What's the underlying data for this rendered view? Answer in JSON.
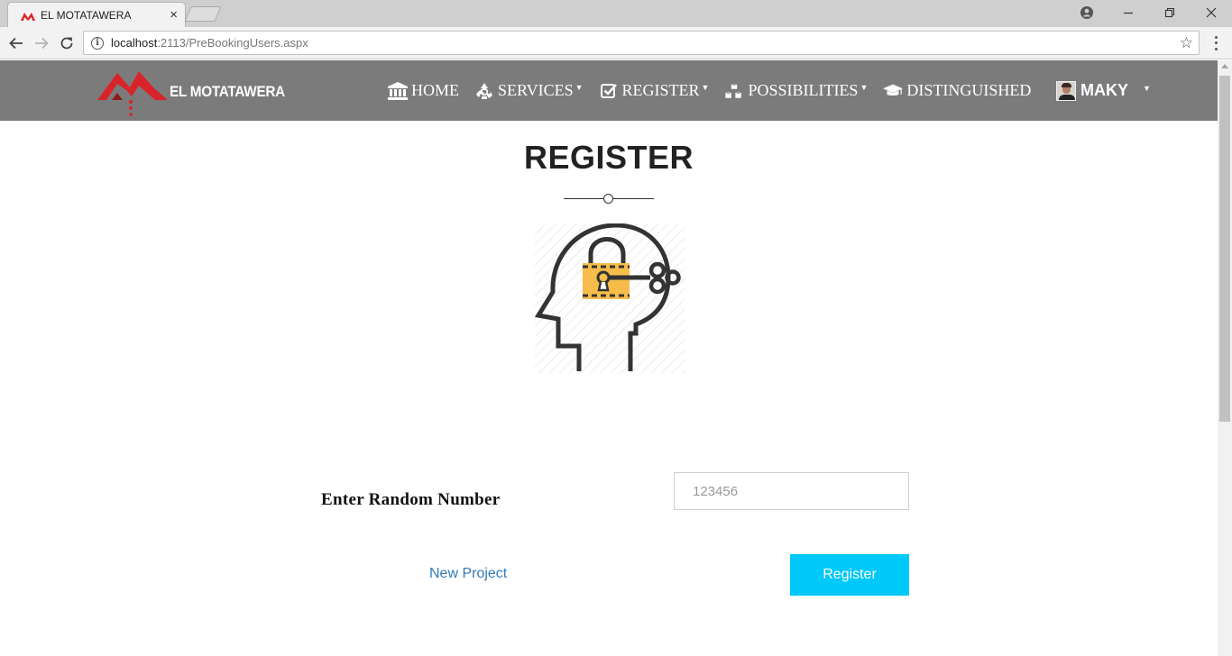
{
  "browser": {
    "tab_title": "EL MOTATAWERA",
    "tab_close": "×",
    "url_host": "localhost",
    "url_path": ":2113/PreBookingUsers.aspx"
  },
  "navbar": {
    "brand": "EL MOTATAWERA",
    "items": [
      {
        "label": "HOME",
        "icon": "bank-icon",
        "has_dropdown": false
      },
      {
        "label": "SERVICES",
        "icon": "recycle-icon",
        "has_dropdown": true
      },
      {
        "label": "REGISTER",
        "icon": "checkbox-icon",
        "has_dropdown": true
      },
      {
        "label": "POSSIBILITIES",
        "icon": "cubes-icon",
        "has_dropdown": true
      },
      {
        "label": "DISTINGUISHED",
        "icon": "graduation-cap-icon",
        "has_dropdown": false
      }
    ],
    "user": {
      "name": "MAKY",
      "has_dropdown": true
    }
  },
  "main": {
    "title": "REGISTER",
    "form": {
      "random_number_label": "Enter Random Number",
      "random_number_value": "",
      "random_number_placeholder": "123456",
      "new_project_link": "New Project",
      "register_button": "Register"
    }
  },
  "colors": {
    "navbar_bg": "#7b7b7b",
    "brand_red": "#d9232a",
    "link_blue": "#337ab7",
    "button_cyan": "#00c8f8",
    "lock_yellow": "#f6bd4b",
    "icon_dark": "#333333"
  }
}
